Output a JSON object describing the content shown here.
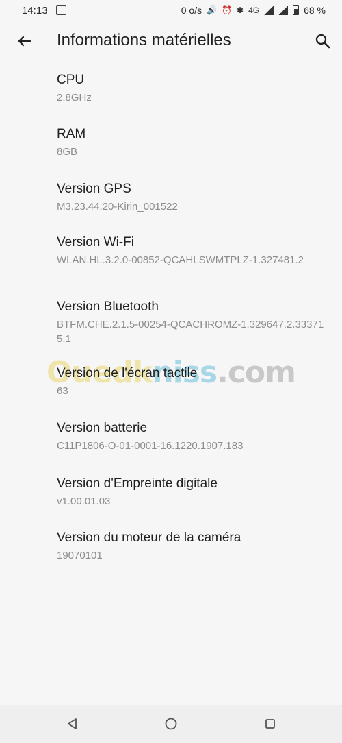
{
  "status_bar": {
    "time": "14:13",
    "speed": "0 o/s",
    "network": "4G",
    "battery": "68 %"
  },
  "header": {
    "title": "Informations matérielles"
  },
  "items": [
    {
      "label": "CPU",
      "value": "2.8GHz"
    },
    {
      "label": "RAM",
      "value": "8GB"
    },
    {
      "label": "Version GPS",
      "value": "M3.23.44.20-Kirin_001522"
    },
    {
      "label": "Version Wi-Fi",
      "value": "WLAN.HL.3.2.0-00852-QCAHLSWMTPLZ-1.327481.2"
    },
    {
      "label": "Version Bluetooth",
      "value": "BTFM.CHE.2.1.5-00254-QCACHROMZ-1.329647.2.333715.1"
    },
    {
      "label": "Version de l'écran tactile",
      "value": "63"
    },
    {
      "label": "Version batterie",
      "value": "C11P1806-O-01-0001-16.1220.1907.183"
    },
    {
      "label": "Version d'Empreinte digitale",
      "value": "v1.00.01.03"
    },
    {
      "label": "Version du moteur de la caméra",
      "value": "19070101"
    }
  ],
  "watermark": {
    "part1": "Ouedk",
    "part2": "niss",
    "part3": ".com"
  }
}
